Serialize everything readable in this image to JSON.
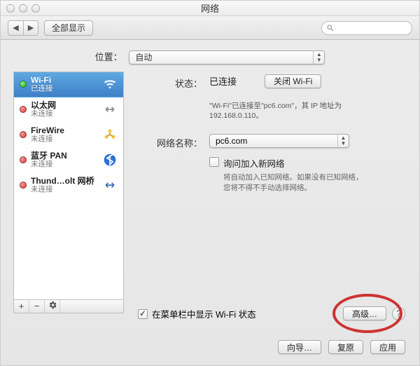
{
  "window_title": "网络",
  "toolbar": {
    "show_all": "全部显示"
  },
  "location": {
    "label": "位置：",
    "value": "自动"
  },
  "sidebar": {
    "items": [
      {
        "name": "Wi-Fi",
        "status": "已连接"
      },
      {
        "name": "以太网",
        "status": "未连接"
      },
      {
        "name": "FireWire",
        "status": "未连接"
      },
      {
        "name": "蓝牙 PAN",
        "status": "未连接"
      },
      {
        "name": "Thund…olt 网桥",
        "status": "未连接"
      }
    ]
  },
  "detail": {
    "status_label": "状态：",
    "status_value": "已连接",
    "wifi_off_btn": "关闭 Wi-Fi",
    "status_desc": "\"Wi-Fi\"已连接至\"pc6.com\"，其 IP 地址为 192.168.0.110。",
    "network_name_label": "网络名称：",
    "network_name_value": "pc6.com",
    "ask_join_label": "询问加入新网络",
    "ask_join_desc": "将自动加入已知网络。如果没有已知网络，您将不得不手动选择网络。",
    "show_status_label": "在菜单栏中显示 Wi-Fi 状态",
    "advanced_btn": "高级…"
  },
  "footer": {
    "wizard": "向导…",
    "revert": "复原",
    "apply": "应用"
  }
}
